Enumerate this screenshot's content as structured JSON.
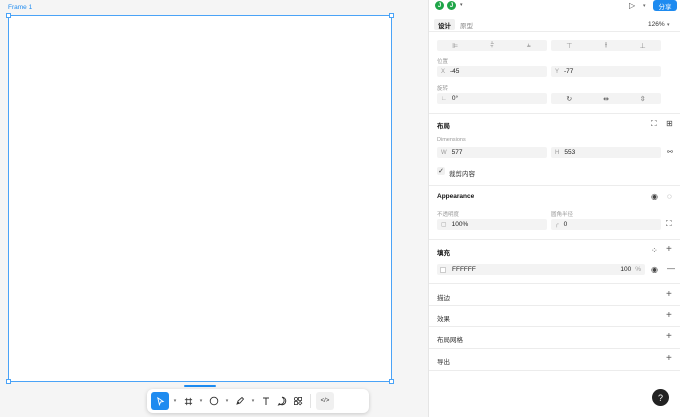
{
  "canvas": {
    "frame_label": "Frame 1"
  },
  "toolbar": {
    "tools": [
      {
        "name": "move-tool",
        "glyph": "↖"
      },
      {
        "name": "frame-tool",
        "glyph": "#"
      },
      {
        "name": "ellipse-tool",
        "glyph": "○"
      },
      {
        "name": "pen-tool",
        "glyph": "✎"
      },
      {
        "name": "text-tool",
        "glyph": "T"
      },
      {
        "name": "comment-tool",
        "glyph": "◯"
      },
      {
        "name": "components-tool",
        "glyph": "⁘"
      },
      {
        "name": "dev-mode-tool",
        "glyph": "</>"
      }
    ]
  },
  "header": {
    "avatar1": "J",
    "avatar2": "J",
    "share_label": "分享",
    "zoom": "126%"
  },
  "tabs": {
    "design": "设计",
    "prototype": "原型"
  },
  "position": {
    "label": "位置",
    "x_prefix": "X",
    "x_value": "-45",
    "y_prefix": "Y",
    "y_value": "-77"
  },
  "rotation": {
    "label": "旋转",
    "value": "0°"
  },
  "layout": {
    "title": "布局",
    "dimensions_label": "Dimensions",
    "w_prefix": "W",
    "w_value": "577",
    "h_prefix": "H",
    "h_value": "553",
    "clip_label": "裁剪内容"
  },
  "appearance": {
    "title": "Appearance",
    "opacity_label": "不透明度",
    "opacity_value": "100%",
    "radius_label": "圆角半径",
    "radius_value": "0"
  },
  "fill": {
    "title": "填充",
    "hex": "FFFFFF",
    "opacity": "100",
    "percent": "%"
  },
  "sections": {
    "stroke": "描边",
    "effects": "效果",
    "layout_grid": "布局网格",
    "export": "导出"
  },
  "help": "?",
  "colors": {
    "accent": "#1e8bf0",
    "avatar": "#1fa548"
  }
}
